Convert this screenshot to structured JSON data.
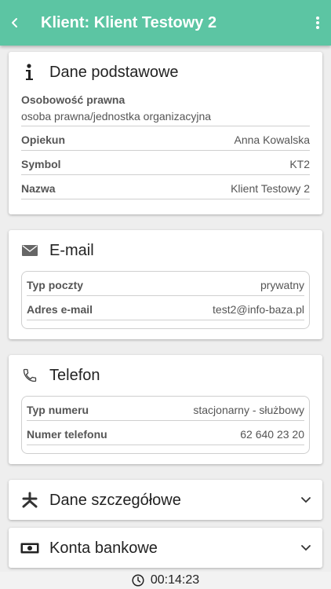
{
  "appbar": {
    "title": "Klient: Klient Testowy 2",
    "back_icon": "arrow-left-icon",
    "menu_icon": "more-vert-icon",
    "color": "#5cc5a3"
  },
  "basic": {
    "title": "Dane podstawowe",
    "legal_label": "Osobowość prawna",
    "legal_value": "osoba prawna/jednostka organizacyjna",
    "rows": [
      {
        "label": "Opiekun",
        "value": "Anna Kowalska"
      },
      {
        "label": "Symbol",
        "value": "KT2"
      },
      {
        "label": "Nazwa",
        "value": "Klient Testowy 2"
      }
    ]
  },
  "email": {
    "title": "E-mail",
    "rows": [
      {
        "label": "Typ poczty",
        "value": "prywatny"
      },
      {
        "label": "Adres e-mail",
        "value": "test2@info-baza.pl"
      }
    ]
  },
  "phone": {
    "title": "Telefon",
    "rows": [
      {
        "label": "Typ numeru",
        "value": "stacjonarny - służbowy"
      },
      {
        "label": "Numer telefonu",
        "value": "62 640 23 20"
      }
    ]
  },
  "details": {
    "title": "Dane szczegółowe"
  },
  "bank": {
    "title": "Konta bankowe"
  },
  "footer": {
    "timer": "00:14:23"
  }
}
